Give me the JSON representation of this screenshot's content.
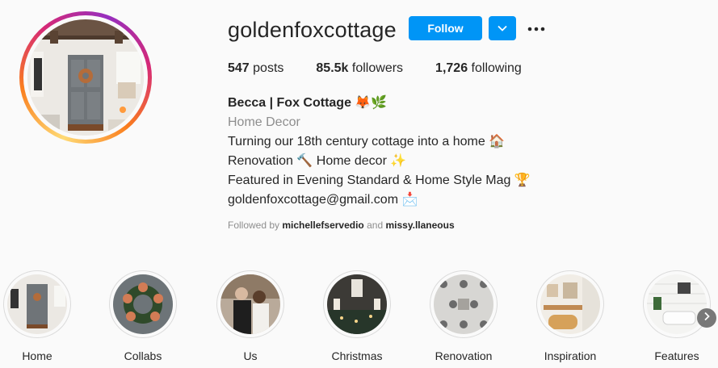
{
  "profile": {
    "username": "goldenfoxcottage",
    "follow_label": "Follow",
    "posts_count": "547",
    "posts_label": "posts",
    "followers_count": "85.5k",
    "followers_label": "followers",
    "following_count": "1,726",
    "following_label": "following"
  },
  "bio": {
    "name": "Becca | Fox Cottage 🦊🌿",
    "category": "Home Decor",
    "lines": [
      "Turning our 18th century cottage into a home 🏠",
      "Renovation 🔨 Home decor ✨",
      "Featured in Evening Standard & Home Style Mag 🏆",
      "goldenfoxcottage@gmail.com 📩"
    ]
  },
  "followed_by": {
    "prefix": "Followed by",
    "user1": "michellefservedio",
    "conj": "and",
    "user2": "missy.llaneous"
  },
  "highlights": [
    {
      "label": "Home"
    },
    {
      "label": "Collabs"
    },
    {
      "label": "Us"
    },
    {
      "label": "Christmas"
    },
    {
      "label": "Renovation"
    },
    {
      "label": "Inspiration"
    },
    {
      "label": "Features"
    }
  ],
  "icons": {
    "dropdown": "chevron-down-icon",
    "more": "more-horizontal-icon",
    "next": "chevron-right-icon"
  },
  "colors": {
    "accent": "#0095f6",
    "muted": "#8e8e8e",
    "text": "#262626"
  }
}
